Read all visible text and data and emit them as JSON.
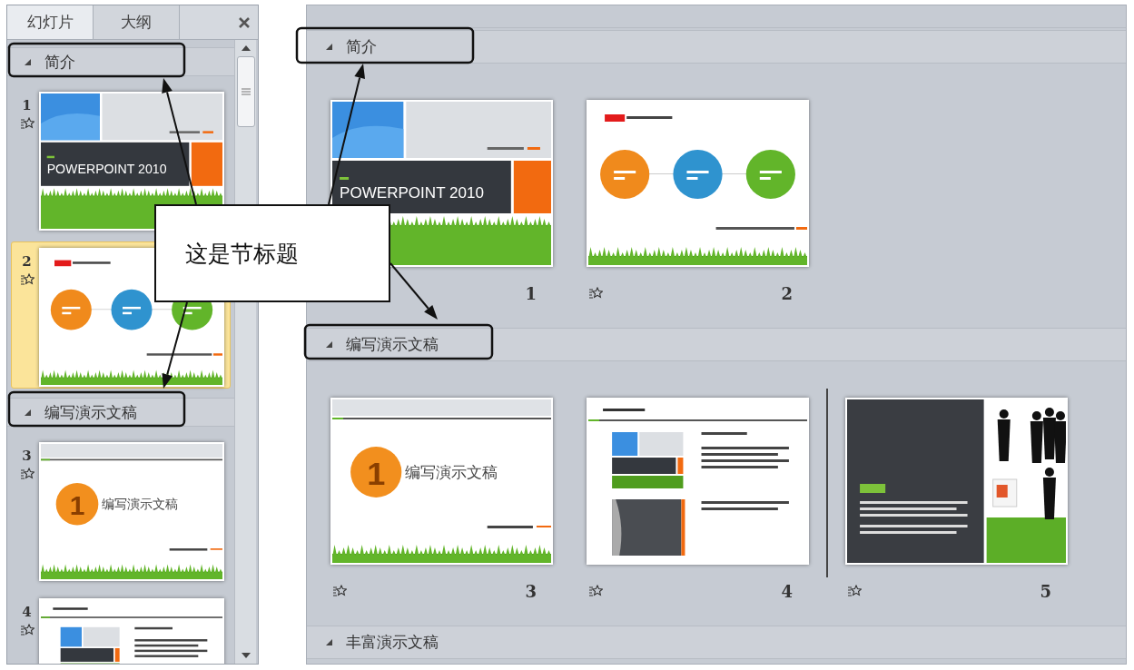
{
  "slide_pane": {
    "tabs": [
      {
        "label": "幻灯片",
        "selected": true
      },
      {
        "label": "大纲",
        "selected": false
      }
    ],
    "sections": [
      {
        "title": "简介",
        "expanded": true,
        "slides": [
          {
            "number": "1",
            "animated": true,
            "selected": false,
            "kind": "title",
            "text": "POWERPOINT 2010"
          },
          {
            "number": "2",
            "animated": true,
            "selected": true,
            "kind": "circles"
          }
        ]
      },
      {
        "title": "编写演示文稿",
        "expanded": true,
        "slides": [
          {
            "number": "3",
            "animated": true,
            "selected": false,
            "kind": "section",
            "badge": "1",
            "text": "编写演示文稿"
          },
          {
            "number": "4",
            "animated": true,
            "selected": false,
            "kind": "content"
          }
        ]
      }
    ]
  },
  "slide_sorter": {
    "sections": [
      {
        "title": "简介",
        "expanded": true,
        "slides": [
          {
            "number": "1",
            "kind": "title",
            "text": "POWERPOINT 2010"
          },
          {
            "number": "2",
            "animated": true,
            "kind": "circles"
          }
        ]
      },
      {
        "title": "编写演示文稿",
        "expanded": true,
        "slides": [
          {
            "number": "3",
            "animated": true,
            "kind": "section",
            "badge": "1",
            "text": "编写演示文稿"
          },
          {
            "number": "4",
            "animated": true,
            "kind": "content"
          },
          {
            "number": "5",
            "animated": true,
            "insert_before": true,
            "kind": "people"
          }
        ]
      },
      {
        "title": "丰富演示文稿",
        "expanded": true
      }
    ]
  },
  "annotation": {
    "callout": "这是节标题"
  }
}
